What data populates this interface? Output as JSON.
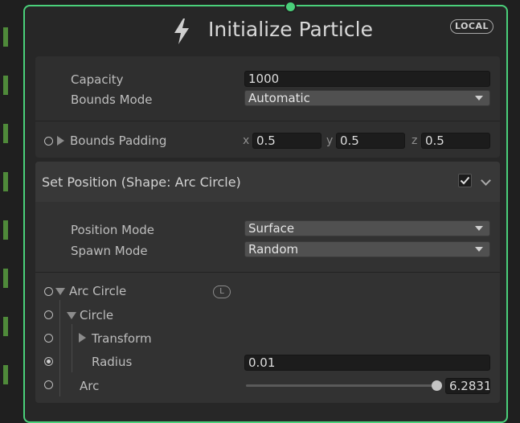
{
  "node": {
    "title": "Initialize Particle",
    "space_badge": "LOCAL",
    "icon": "lightning-bolt-icon",
    "accent_color": "#4ad07a"
  },
  "init": {
    "capacity_label": "Capacity",
    "capacity_value": "1000",
    "bounds_mode_label": "Bounds Mode",
    "bounds_mode_value": "Automatic",
    "bounds_padding_label": "Bounds Padding",
    "bounds_padding": {
      "x_label": "x",
      "x": "0.5",
      "y_label": "y",
      "y": "0.5",
      "z_label": "z",
      "z": "0.5"
    }
  },
  "set_position": {
    "title": "Set Position (Shape: Arc Circle)",
    "enabled": true,
    "position_mode_label": "Position Mode",
    "position_mode_value": "Surface",
    "spawn_mode_label": "Spawn Mode",
    "spawn_mode_value": "Random",
    "arc_circle_label": "Arc Circle",
    "arc_circle_badge": "L",
    "circle_label": "Circle",
    "transform_label": "Transform",
    "radius_label": "Radius",
    "radius_value": "0.01",
    "arc_label": "Arc",
    "arc_value": "6.2831",
    "arc_slider_fraction": 0.99
  }
}
